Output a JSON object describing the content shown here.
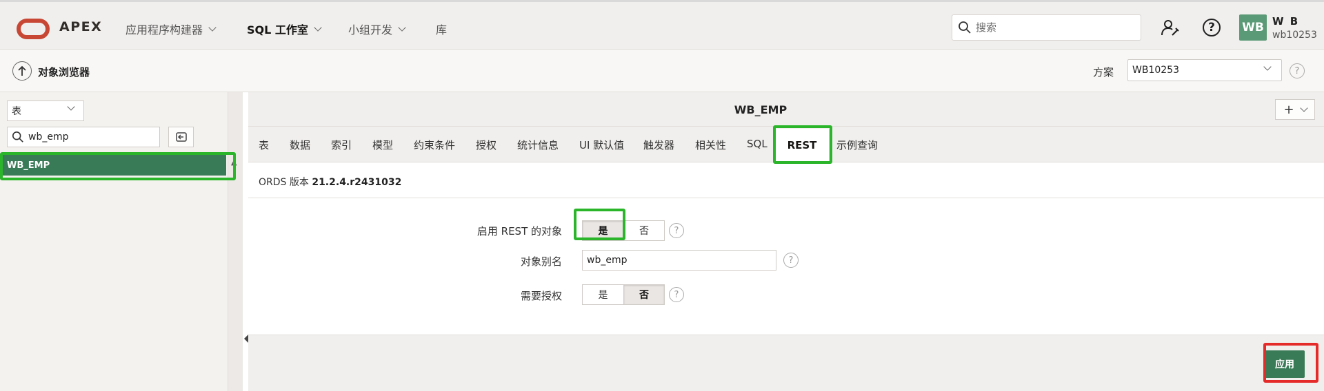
{
  "header": {
    "brand": "APEX",
    "nav": [
      {
        "label": "应用程序构建器"
      },
      {
        "label": "SQL 工作室"
      },
      {
        "label": "小组开发"
      },
      {
        "label": "库"
      }
    ],
    "search_placeholder": "搜索",
    "user": {
      "initials": "WB",
      "name": "W B",
      "id": "wb10253"
    }
  },
  "subheader": {
    "breadcrumb": "对象浏览器",
    "schema_label": "方案",
    "schema_value": "WB10253",
    "help": "?"
  },
  "sidebar": {
    "object_type": "表",
    "filter_value": "wb_emp",
    "items": [
      {
        "label": "WB_EMP"
      }
    ]
  },
  "main": {
    "title": "WB_EMP",
    "add_label": "+",
    "tabs": [
      {
        "label": "表"
      },
      {
        "label": "数据"
      },
      {
        "label": "索引"
      },
      {
        "label": "模型"
      },
      {
        "label": "约束条件"
      },
      {
        "label": "授权"
      },
      {
        "label": "统计信息"
      },
      {
        "label": "UI 默认值"
      },
      {
        "label": "触发器"
      },
      {
        "label": "相关性"
      },
      {
        "label": "SQL"
      },
      {
        "label": "REST"
      },
      {
        "label": "示例查询"
      }
    ],
    "ords_label": "ORDS 版本",
    "ords_version": "21.2.4.r2431032",
    "form": {
      "enable_label": "启用 REST 的对象",
      "enable_options": [
        "是",
        "否"
      ],
      "enable_selected": "是",
      "alias_label": "对象别名",
      "alias_value": "wb_emp",
      "auth_label": "需要授权",
      "auth_options": [
        "是",
        "否"
      ],
      "auth_selected": "否",
      "help": "?"
    },
    "apply_label": "应用"
  },
  "colors": {
    "accent_green": "#3a7b57",
    "highlight_green": "#2bb52b",
    "highlight_red": "#e52a2a",
    "oracle_red": "#c74634"
  }
}
